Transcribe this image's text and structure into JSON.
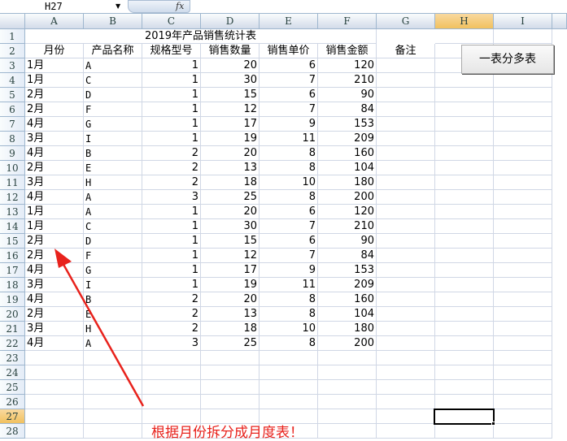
{
  "formula_bar": {
    "name_box": "H27",
    "fx": "fx"
  },
  "columns": [
    "A",
    "B",
    "C",
    "D",
    "E",
    "F",
    "G",
    "H",
    "I"
  ],
  "selected_column": "H",
  "selected_row": 27,
  "title": "2019年产品销售统计表",
  "headers": [
    "月份",
    "产品名称",
    "规格型号",
    "销售数量",
    "销售单价",
    "销售金额",
    "备注"
  ],
  "rows": [
    [
      "1月",
      "A",
      "1",
      "20",
      "6",
      "120"
    ],
    [
      "1月",
      "C",
      "1",
      "30",
      "7",
      "210"
    ],
    [
      "2月",
      "D",
      "1",
      "15",
      "6",
      "90"
    ],
    [
      "2月",
      "F",
      "1",
      "12",
      "7",
      "84"
    ],
    [
      "4月",
      "G",
      "1",
      "17",
      "9",
      "153"
    ],
    [
      "3月",
      "I",
      "1",
      "19",
      "11",
      "209"
    ],
    [
      "4月",
      "B",
      "2",
      "20",
      "8",
      "160"
    ],
    [
      "2月",
      "E",
      "2",
      "13",
      "8",
      "104"
    ],
    [
      "3月",
      "H",
      "2",
      "18",
      "10",
      "180"
    ],
    [
      "4月",
      "A",
      "3",
      "25",
      "8",
      "200"
    ],
    [
      "1月",
      "A",
      "1",
      "20",
      "6",
      "120"
    ],
    [
      "1月",
      "C",
      "1",
      "30",
      "7",
      "210"
    ],
    [
      "2月",
      "D",
      "1",
      "15",
      "6",
      "90"
    ],
    [
      "2月",
      "F",
      "1",
      "12",
      "7",
      "84"
    ],
    [
      "4月",
      "G",
      "1",
      "17",
      "9",
      "153"
    ],
    [
      "3月",
      "I",
      "1",
      "19",
      "11",
      "209"
    ],
    [
      "4月",
      "B",
      "2",
      "20",
      "8",
      "160"
    ],
    [
      "2月",
      "E",
      "2",
      "13",
      "8",
      "104"
    ],
    [
      "3月",
      "H",
      "2",
      "18",
      "10",
      "180"
    ],
    [
      "4月",
      "A",
      "3",
      "25",
      "8",
      "200"
    ]
  ],
  "row_count": 28,
  "button_label": "一表分多表",
  "annotation": "根据月份拆分成月度表！",
  "colors": {
    "annotation": "#e8221c",
    "selected_header": "#f1c15f"
  }
}
